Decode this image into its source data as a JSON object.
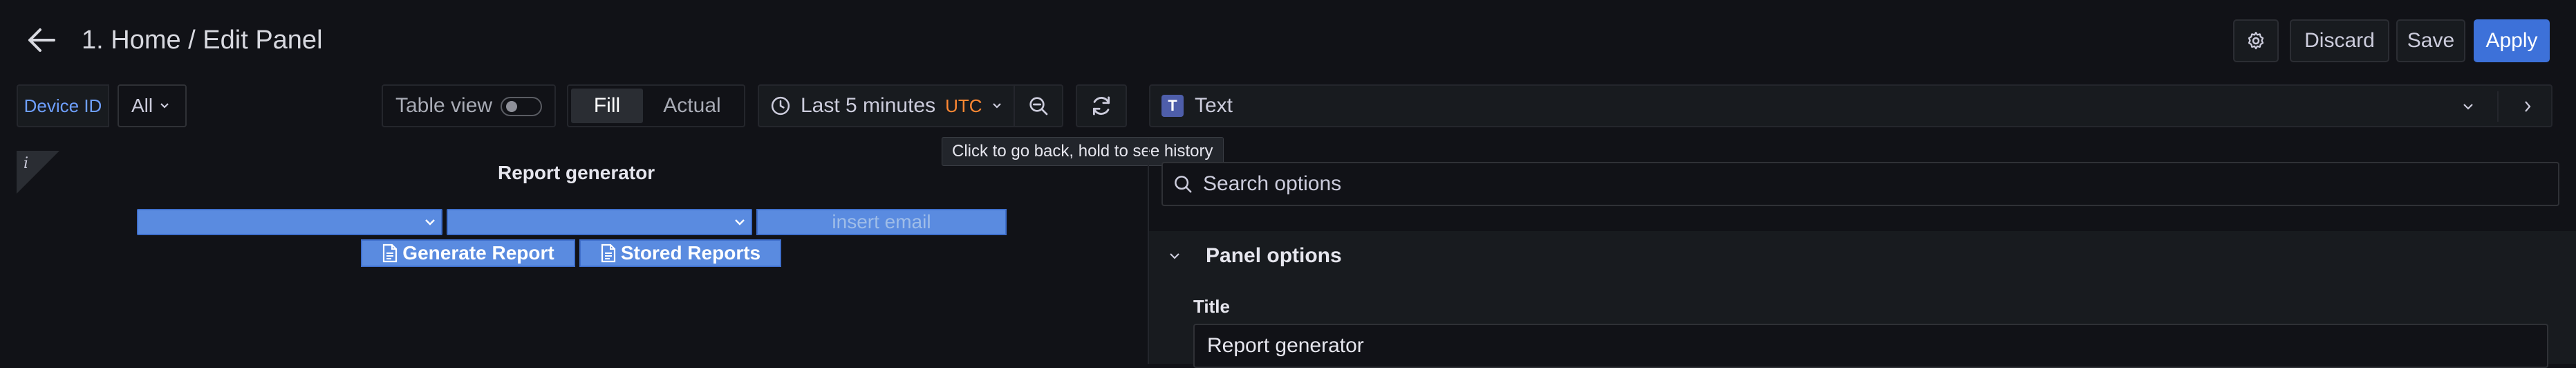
{
  "header": {
    "title": "1. Home / Edit Panel",
    "discard_label": "Discard",
    "save_label": "Save",
    "apply_label": "Apply",
    "apply_color": "#3d71d9"
  },
  "variables": {
    "device_label": "Device ID",
    "device_value": "All"
  },
  "controls": {
    "table_view_label": "Table view",
    "table_view_on": false,
    "fill_label": "Fill",
    "actual_label": "Actual",
    "time_range": "Last 5 minutes",
    "timezone": "UTC",
    "tooltip": "Click to go back, hold to see history"
  },
  "panel": {
    "info": "i",
    "title": "Report generator",
    "email_placeholder": "insert email",
    "generate_label": "Generate Report",
    "stored_label": "Stored Reports",
    "button_color": "#5a8be0"
  },
  "options": {
    "visualization": "Text",
    "viz_icon": "T",
    "search_placeholder": "Search options",
    "section_title": "Panel options",
    "title_label": "Title",
    "title_value": "Report generator"
  }
}
